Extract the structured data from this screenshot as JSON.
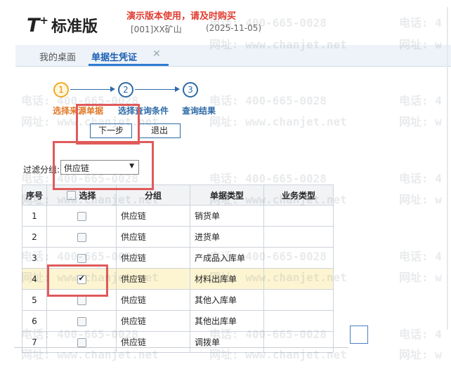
{
  "header": {
    "logo_t": "T",
    "logo_plus": "+",
    "logo_name": "标准版",
    "demo_notice": "演示版本使用，请及时购买",
    "account": "[001]XX矿山",
    "date": "(2025-11-05)"
  },
  "tabs": {
    "desk": "我的桌面",
    "active": "单据生凭证",
    "close_glyph": "✕"
  },
  "steps": [
    {
      "num": "1",
      "label": "选择来源单据"
    },
    {
      "num": "2",
      "label": "选择查询条件"
    },
    {
      "num": "3",
      "label": "查询结果"
    }
  ],
  "buttons": {
    "next": "下一步",
    "exit": "退出"
  },
  "filter": {
    "label": "过滤分组:",
    "value": "供应链",
    "caret": "▼"
  },
  "table": {
    "headers": {
      "no": "序号",
      "select": "选择",
      "group": "分组",
      "doc_type": "单据类型",
      "biz_type": "业务类型"
    },
    "rows": [
      {
        "no": "1",
        "group": "供应链",
        "doc_type": "销货单",
        "biz_type": "",
        "checked": false
      },
      {
        "no": "2",
        "group": "供应链",
        "doc_type": "进货单",
        "biz_type": "",
        "checked": false
      },
      {
        "no": "3",
        "group": "供应链",
        "doc_type": "产成品入库单",
        "biz_type": "",
        "checked": false
      },
      {
        "no": "4",
        "group": "供应链",
        "doc_type": "材料出库单",
        "biz_type": "",
        "checked": true
      },
      {
        "no": "5",
        "group": "供应链",
        "doc_type": "其他入库单",
        "biz_type": "",
        "checked": false
      },
      {
        "no": "6",
        "group": "供应链",
        "doc_type": "其他出库单",
        "biz_type": "",
        "checked": false
      },
      {
        "no": "7",
        "group": "供应链",
        "doc_type": "调拨单",
        "biz_type": "",
        "checked": false
      }
    ]
  },
  "watermark": {
    "phone": "电话: 400-665-0028",
    "web": "网址: www.chanjet.net",
    "phone_short": "电话: 4",
    "web_short": "网址: w"
  }
}
